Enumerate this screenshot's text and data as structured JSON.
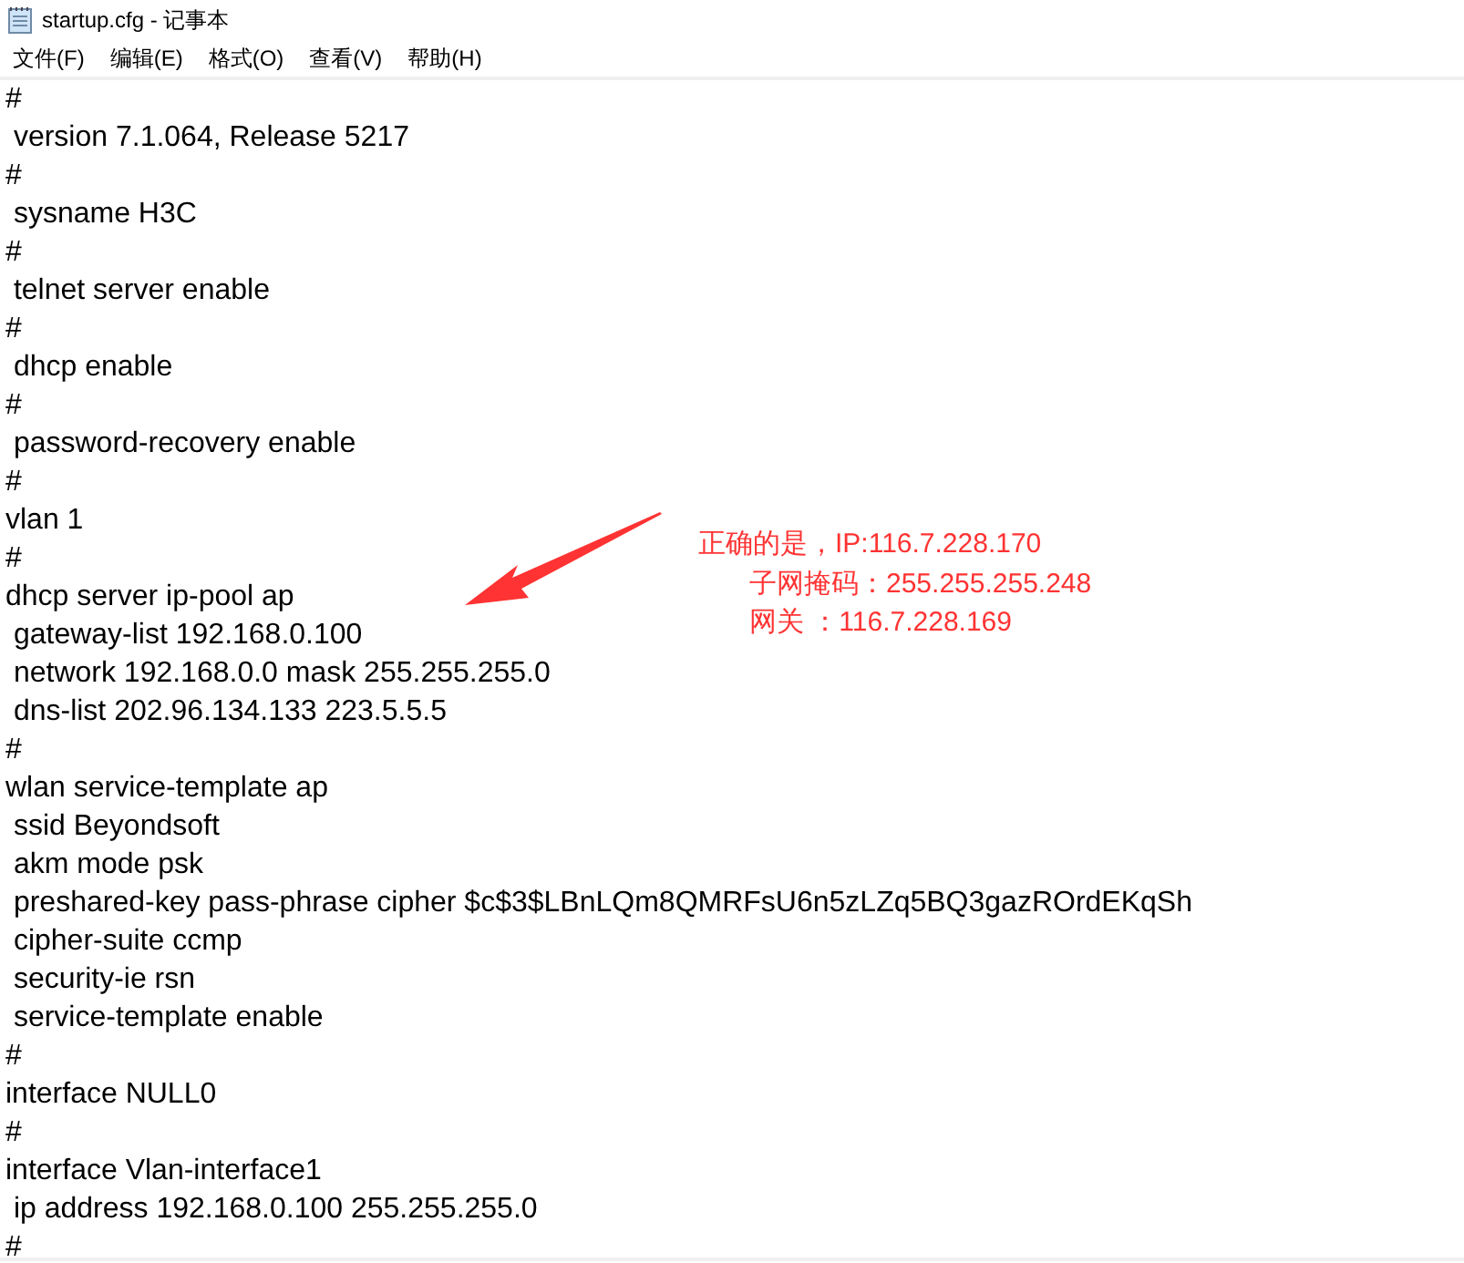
{
  "window": {
    "title": "startup.cfg - 记事本"
  },
  "menu": [
    "文件(F)",
    "编辑(E)",
    "格式(O)",
    "查看(V)",
    "帮助(H)"
  ],
  "lines": [
    "#",
    " version 7.1.064, Release 5217",
    "#",
    " sysname H3C",
    "#",
    " telnet server enable",
    "#",
    " dhcp enable",
    "#",
    " password-recovery enable",
    "#",
    "vlan 1",
    "#",
    "dhcp server ip-pool ap",
    " gateway-list 192.168.0.100",
    " network 192.168.0.0 mask 255.255.255.0",
    " dns-list 202.96.134.133 223.5.5.5",
    "#",
    "wlan service-template ap",
    " ssid Beyondsoft",
    " akm mode psk",
    " preshared-key pass-phrase cipher $c$3$LBnLQm8QMRFsU6n5zLZq5BQ3gazROrdEKqSh",
    " cipher-suite ccmp",
    " security-ie rsn",
    " service-template enable",
    "#",
    "interface NULL0",
    "#",
    "interface Vlan-interface1",
    " ip address 192.168.0.100 255.255.255.0",
    "#"
  ],
  "annotation": {
    "color": "#ff3333",
    "lines": [
      "正确的是，IP:116.7.228.170",
      "子网掩码：255.255.255.248",
      "网关 ：116.7.228.169"
    ]
  }
}
